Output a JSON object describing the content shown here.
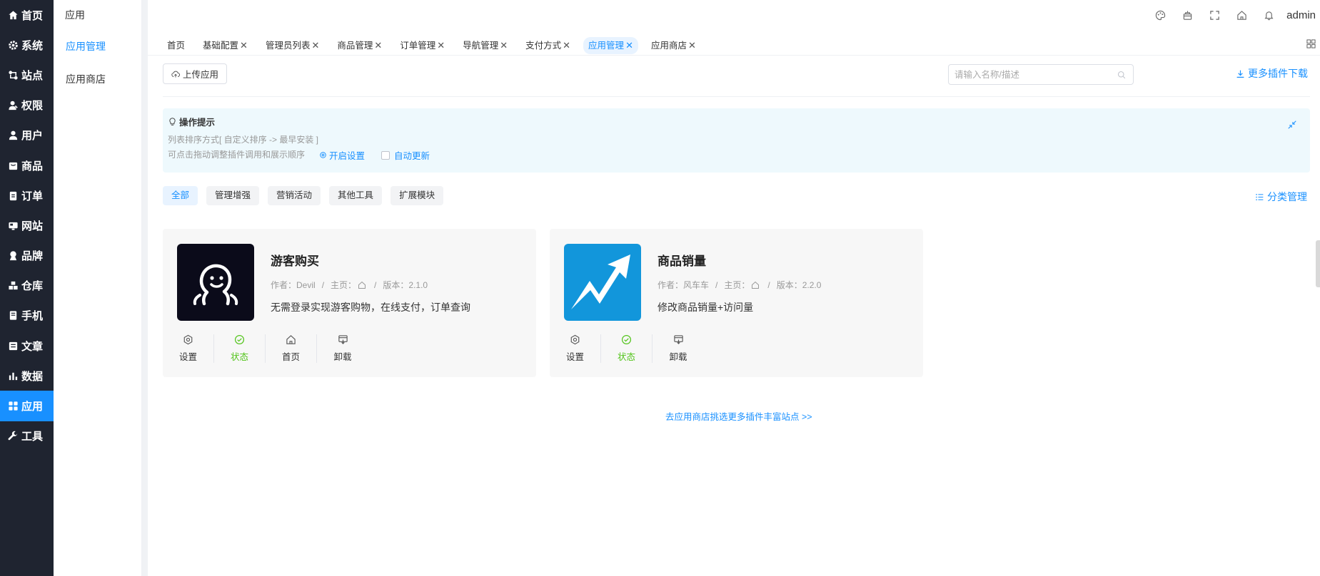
{
  "sidebar": {
    "items": [
      {
        "label": "首页",
        "icon": "home-icon"
      },
      {
        "label": "系统",
        "icon": "gear-icon"
      },
      {
        "label": "站点",
        "icon": "site-icon"
      },
      {
        "label": "权限",
        "icon": "permission-icon"
      },
      {
        "label": "用户",
        "icon": "user-icon"
      },
      {
        "label": "商品",
        "icon": "goods-icon"
      },
      {
        "label": "订单",
        "icon": "order-icon"
      },
      {
        "label": "网站",
        "icon": "website-icon"
      },
      {
        "label": "品牌",
        "icon": "brand-icon"
      },
      {
        "label": "仓库",
        "icon": "warehouse-icon"
      },
      {
        "label": "手机",
        "icon": "phone-icon"
      },
      {
        "label": "文章",
        "icon": "article-icon"
      },
      {
        "label": "数据",
        "icon": "chart-icon"
      },
      {
        "label": "应用",
        "icon": "apps-icon",
        "active": true
      },
      {
        "label": "工具",
        "icon": "wrench-icon"
      }
    ]
  },
  "submenu": {
    "title": "应用",
    "items": [
      {
        "label": "应用管理",
        "active": true
      },
      {
        "label": "应用商店"
      }
    ]
  },
  "header": {
    "icons": [
      "palette-icon",
      "clear-cache-icon",
      "fullscreen-icon",
      "home-icon",
      "bell-icon"
    ],
    "user": "admin"
  },
  "tabs": [
    {
      "label": "首页",
      "closable": false
    },
    {
      "label": "基础配置",
      "closable": true
    },
    {
      "label": "管理员列表",
      "closable": true
    },
    {
      "label": "商品管理",
      "closable": true
    },
    {
      "label": "订单管理",
      "closable": true
    },
    {
      "label": "导航管理",
      "closable": true
    },
    {
      "label": "支付方式",
      "closable": true
    },
    {
      "label": "应用管理",
      "closable": true,
      "active": true
    },
    {
      "label": "应用商店",
      "closable": true
    }
  ],
  "toolbar": {
    "upload_label": "上传应用",
    "search_placeholder": "请输入名称/描述",
    "more_download_label": "更多插件下载"
  },
  "tip": {
    "title": "操作提示",
    "line1": "列表排序方式[ 自定义排序 -> 最早安装 ]",
    "line2": "可点击拖动调整插件调用和展示顺序",
    "setting_label": "开启设置",
    "auto_update_label": "自动更新"
  },
  "categories": {
    "items": [
      {
        "label": "全部",
        "active": true
      },
      {
        "label": "管理增强"
      },
      {
        "label": "营销活动"
      },
      {
        "label": "其他工具"
      },
      {
        "label": "扩展模块"
      }
    ],
    "manage_label": "分类管理"
  },
  "plugins": [
    {
      "name": "游客购买",
      "author_label": "作者：Devil",
      "homepage_label": "主页：",
      "version_label": "版本：2.1.0",
      "description": "无需登录实现游客购物，在线支付，订单查询",
      "logo_color": "#0b0b1a",
      "actions": [
        "设置",
        "状态",
        "首页",
        "卸载"
      ]
    },
    {
      "name": "商品销量",
      "author_label": "作者：风车车",
      "homepage_label": "主页：",
      "version_label": "版本：2.2.0",
      "description": "修改商品销量+访问量",
      "logo_color": "#1296db",
      "actions": [
        "设置",
        "状态",
        "卸载"
      ]
    }
  ],
  "store_link": "去应用商店挑选更多插件丰富站点 >>",
  "colors": {
    "sidebar_bg": "#1f2430",
    "accent": "#1890ff",
    "status_green": "#52c41a",
    "tip_bg": "#eef9fd"
  }
}
